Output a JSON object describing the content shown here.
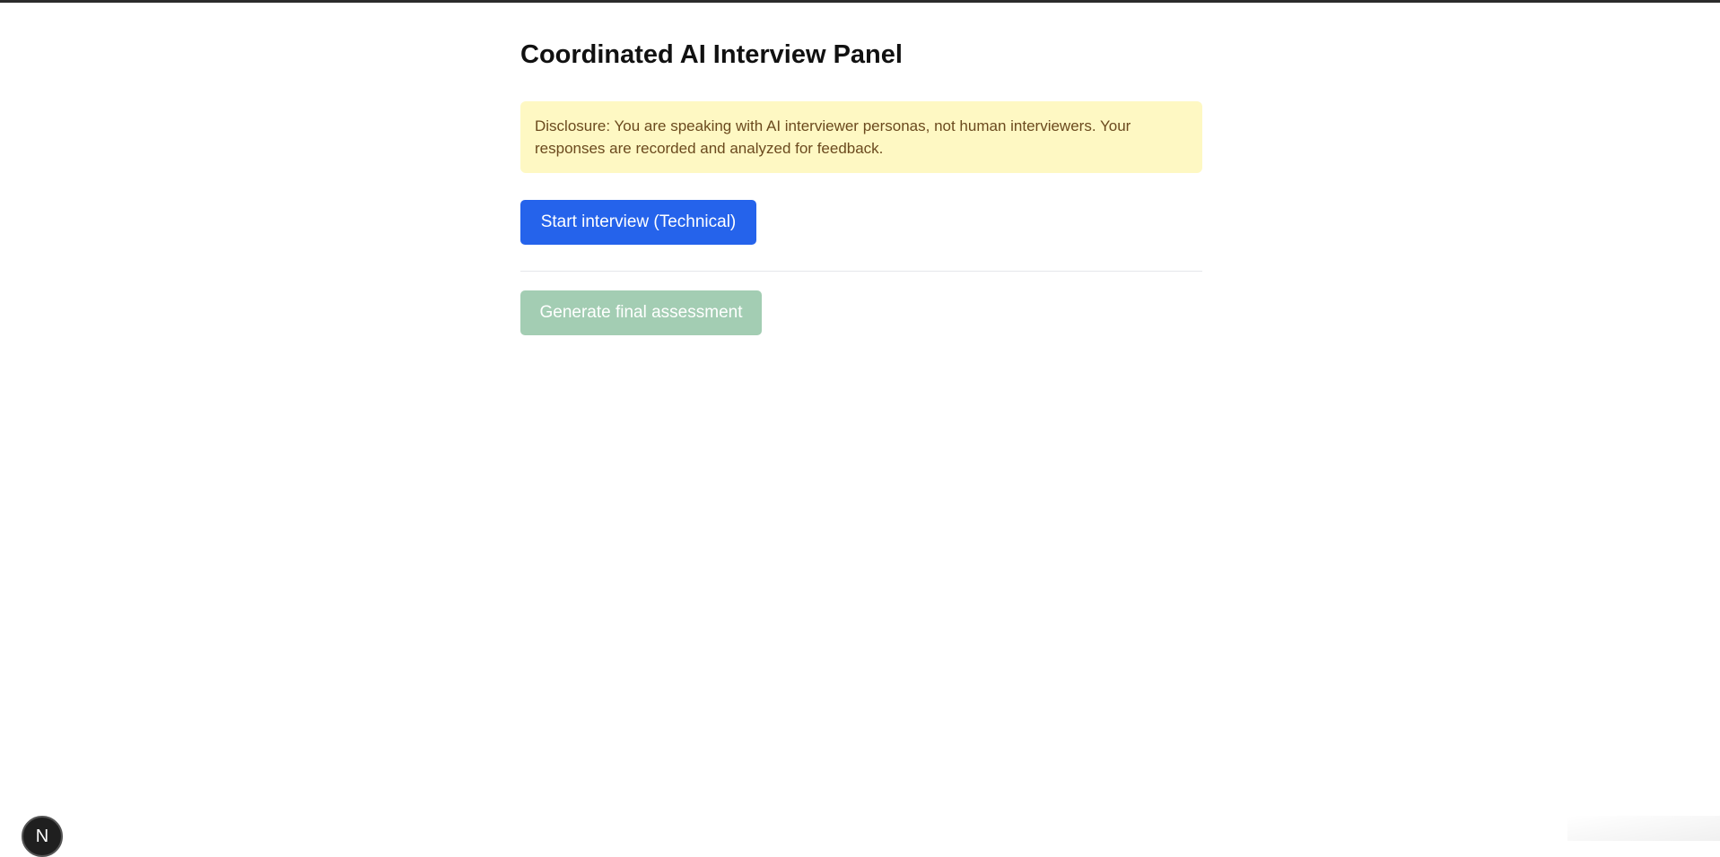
{
  "page": {
    "title": "Coordinated AI Interview Panel"
  },
  "disclosure": {
    "text": "Disclosure: You are speaking with AI interviewer personas, not human interviewers. Your responses are recorded and analyzed for feedback."
  },
  "actions": {
    "start_label": "Start interview (Technical)",
    "assessment_label": "Generate final assessment",
    "assessment_disabled": true
  },
  "dev_badge": {
    "label": "N"
  },
  "colors": {
    "primary": "#2563eb",
    "disabled_success": "#a3cdb3",
    "disclosure_bg": "#fef8c3",
    "disclosure_text": "#6b4a1e"
  }
}
